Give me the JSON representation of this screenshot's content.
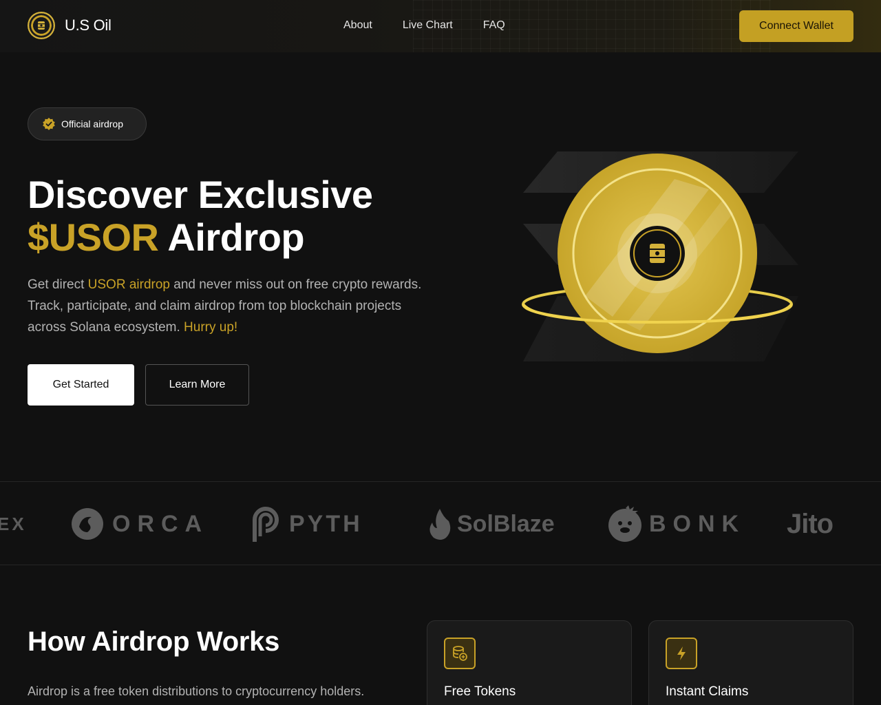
{
  "header": {
    "brand": "U.S Oil",
    "nav": [
      "About",
      "Live Chart",
      "FAQ"
    ],
    "connect_label": "Connect Wallet"
  },
  "hero": {
    "badge": "Official airdrop",
    "title_line1": "Discover Exclusive",
    "title_gold": "$USOR",
    "title_rest": " Airdrop",
    "desc_part1": "Get direct ",
    "desc_gold1": "USOR airdrop",
    "desc_part2": " and never miss out on free crypto rewards. Track, participate, and claim airdrop from top blockchain projects across Solana ecosystem. ",
    "desc_gold2": "Hurry up!",
    "primary_label": "Get Started",
    "secondary_label": "Learn More"
  },
  "partners": {
    "items": [
      "EX",
      "ORCA",
      "PYTH",
      "SolBlaze",
      "BONK",
      "Jito"
    ]
  },
  "how": {
    "title": "How Airdrop Works",
    "desc": "Airdrop is a free token distributions to cryptocurrency holders.",
    "cards": [
      "Free Tokens",
      "Instant Claims"
    ]
  },
  "colors": {
    "accent": "#c9a227",
    "background": "#111111"
  },
  "icons": {
    "logo": "oil-barrel-seal-icon",
    "badge": "verified-check-icon",
    "card1": "coins-stack-icon",
    "card2": "lightning-bolt-icon"
  }
}
